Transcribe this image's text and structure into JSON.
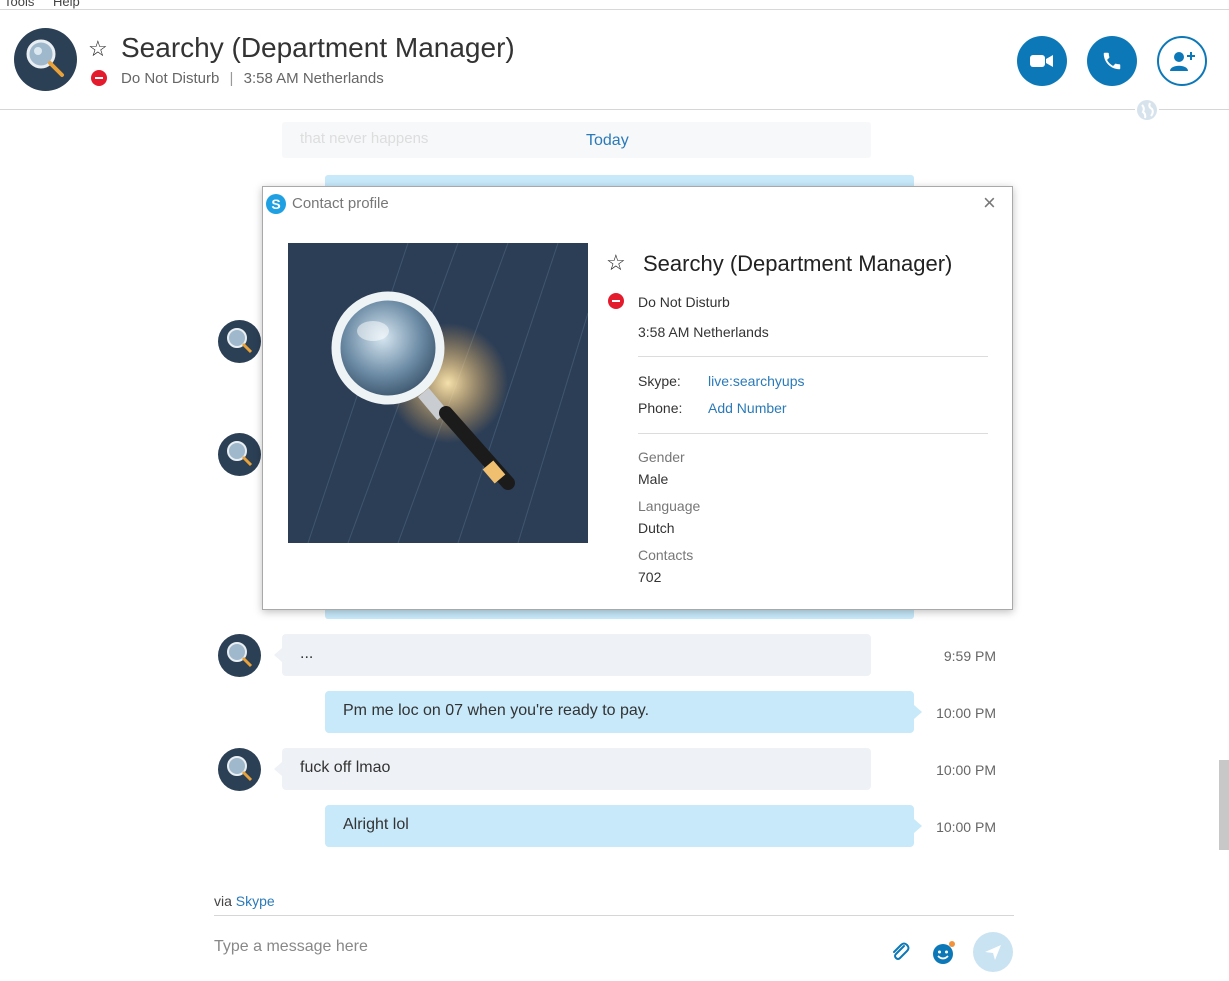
{
  "menu": {
    "tools": "Tools",
    "help": "Help"
  },
  "header": {
    "title": "Searchy (Department Manager)",
    "status": "Do Not Disturb",
    "separator": "|",
    "local_time": "3:58 AM Netherlands"
  },
  "chat": {
    "date_divider": "Today",
    "ghost_message": "that never happens",
    "messages": [
      {
        "direction": "in",
        "text": "...",
        "time": "9:59 PM"
      },
      {
        "direction": "out",
        "text": "Pm me loc on 07 when you're ready to pay.",
        "time": "10:00 PM"
      },
      {
        "direction": "in",
        "text": "fuck off lmao",
        "time": "10:00 PM"
      },
      {
        "direction": "out",
        "text": "Alright lol",
        "time": "10:00 PM"
      }
    ]
  },
  "footer": {
    "via_prefix": "via",
    "via_link": "Skype",
    "composer_placeholder": "Type a message here"
  },
  "profile": {
    "dialog_title": "Contact profile",
    "name": "Searchy (Department Manager)",
    "status": "Do Not Disturb",
    "local_time": "3:58 AM Netherlands",
    "skype_label": "Skype:",
    "skype_value": "live:searchyups",
    "phone_label": "Phone:",
    "phone_value": "Add Number",
    "gender_label": "Gender",
    "gender_value": "Male",
    "language_label": "Language",
    "language_value": "Dutch",
    "contacts_label": "Contacts",
    "contacts_value": "702"
  },
  "colors": {
    "accent": "#0d78b8",
    "dnd": "#e41b2c",
    "bubble_out": "#c7e9fa",
    "bubble_in": "#eef1f5"
  }
}
